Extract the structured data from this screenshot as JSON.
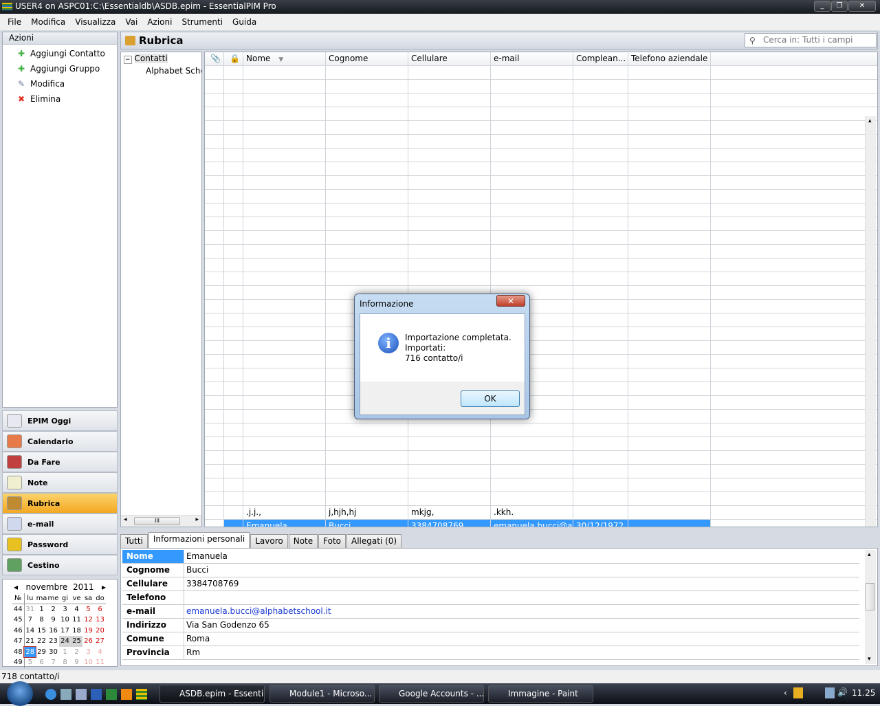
{
  "window": {
    "title": "USER4 on ASPC01:C:\\Essentialdb\\ASDB.epim - EssentialPIM Pro"
  },
  "menu": [
    "File",
    "Modifica",
    "Visualizza",
    "Vai",
    "Azioni",
    "Strumenti",
    "Guida"
  ],
  "actions": {
    "header": "Azioni",
    "items": [
      {
        "label": "Aggiungi Contatto",
        "icon": "plus-icon"
      },
      {
        "label": "Aggiungi Gruppo",
        "icon": "plus-icon"
      },
      {
        "label": "Modifica",
        "icon": "edit-icon"
      },
      {
        "label": "Elimina",
        "icon": "delete-icon"
      }
    ]
  },
  "nav": [
    {
      "label": "EPIM Oggi",
      "color": "#e8e8f0"
    },
    {
      "label": "Calendario",
      "color": "#e87a4a"
    },
    {
      "label": "Da Fare",
      "color": "#c04040"
    },
    {
      "label": "Note",
      "color": "#f0f0d0"
    },
    {
      "label": "Rubrica",
      "color": "#c08a30",
      "active": true
    },
    {
      "label": "e-mail",
      "color": "#d0d8ee"
    },
    {
      "label": "Password",
      "color": "#e8c020"
    },
    {
      "label": "Cestino",
      "color": "#60a060"
    }
  ],
  "calendar": {
    "month": "novembre",
    "year": "2011",
    "headers": [
      "№",
      "lu",
      "ma",
      "me",
      "gi",
      "ve",
      "sa",
      "do"
    ],
    "weeks": [
      [
        "44",
        "31",
        "1",
        "2",
        "3",
        "4",
        "5",
        "6"
      ],
      [
        "45",
        "7",
        "8",
        "9",
        "10",
        "11",
        "12",
        "13"
      ],
      [
        "46",
        "14",
        "15",
        "16",
        "17",
        "18",
        "19",
        "20"
      ],
      [
        "47",
        "21",
        "22",
        "23",
        "24",
        "25",
        "26",
        "27"
      ],
      [
        "48",
        "28",
        "29",
        "30",
        "1",
        "2",
        "3",
        "4"
      ],
      [
        "49",
        "5",
        "6",
        "7",
        "8",
        "9",
        "10",
        "11"
      ]
    ],
    "today": "28"
  },
  "main": {
    "title": "Rubrica",
    "search_placeholder": "Cerca in: Tutti i campi",
    "tree": {
      "root": "Contatti",
      "child": "Alphabet School"
    },
    "columns": [
      "",
      "",
      "Nome",
      "Cognome",
      "Cellulare",
      "e-mail",
      "Complean...",
      "Telefono aziendale"
    ],
    "rows": [
      [
        "",
        "",
        ".j.j.,",
        "j,hjh,hj",
        "mkjg,",
        ".kkh.",
        "",
        ""
      ],
      [
        "",
        "",
        "Emanuela",
        "Bucci",
        "3384708769",
        "emanuela.bucci@alphabetschool.it",
        "30/12/1972",
        ""
      ]
    ]
  },
  "tabs": [
    "Tutti",
    "Informazioni personali",
    "Lavoro",
    "Note",
    "Foto",
    "Allegati (0)"
  ],
  "active_tab": "Informazioni personali",
  "details": [
    {
      "label": "Nome",
      "value": "Emanuela"
    },
    {
      "label": "Cognome",
      "value": "Bucci"
    },
    {
      "label": "Cellulare",
      "value": "3384708769"
    },
    {
      "label": "Telefono",
      "value": ""
    },
    {
      "label": "e-mail",
      "value": "emanuela.bucci@alphabetschool.it",
      "link": true
    },
    {
      "label": "Indirizzo",
      "value": "Via San Godenzo 65"
    },
    {
      "label": "Comune",
      "value": "Roma"
    },
    {
      "label": "Provincia",
      "value": "Rm"
    }
  ],
  "status": "718 contatto/i",
  "dialog": {
    "title": "Informazione",
    "lines": [
      "Importazione completata.",
      "Importati:",
      "716 contatto/i"
    ],
    "ok": "OK"
  },
  "taskbar": {
    "items": [
      "ASDB.epim - Essenti...",
      "Module1 - Microso...",
      "Google Accounts - ...",
      "Immagine - Paint"
    ],
    "clock": "11.25"
  }
}
